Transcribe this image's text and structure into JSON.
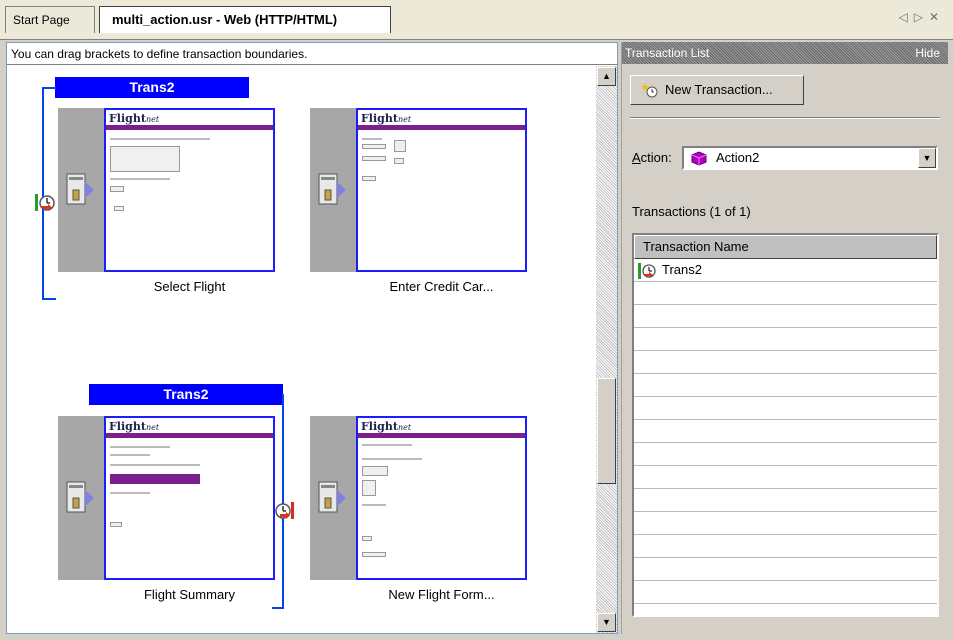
{
  "tabs": [
    {
      "label": "Start Page",
      "active": false
    },
    {
      "label": "multi_action.usr - Web (HTTP/HTML)",
      "active": true
    }
  ],
  "tab_controls": {
    "prev": "◁",
    "next": "▷",
    "close": "✕"
  },
  "left_pane": {
    "hint": "You can drag brackets to define transaction boundaries.",
    "transactions": [
      {
        "label": "Trans2"
      },
      {
        "label": "Trans2"
      }
    ],
    "steps": [
      {
        "caption": "Select Flight",
        "logo": "Flight",
        "logo_suffix": "net"
      },
      {
        "caption": "Enter Credit Car...",
        "logo": "Flight",
        "logo_suffix": "net"
      },
      {
        "caption": "Flight Summary",
        "logo": "Flight",
        "logo_suffix": "net"
      },
      {
        "caption": "New Flight Form...",
        "logo": "Flight",
        "logo_suffix": "net"
      }
    ]
  },
  "right_pane": {
    "title": "Transaction List",
    "hide_label": "Hide",
    "new_button": "New Transaction...",
    "action_label_prefix": "A",
    "action_label_rest": "ction:",
    "action_value": "Action2",
    "transactions_count": "Transactions (1 of 1)",
    "column_header": "Transaction Name",
    "rows": [
      {
        "name": "Trans2"
      }
    ]
  },
  "colors": {
    "accent_blue": "#0000ff",
    "page_bar_purple": "#7a1f8e",
    "action_icon_purple": "#b000c0"
  }
}
